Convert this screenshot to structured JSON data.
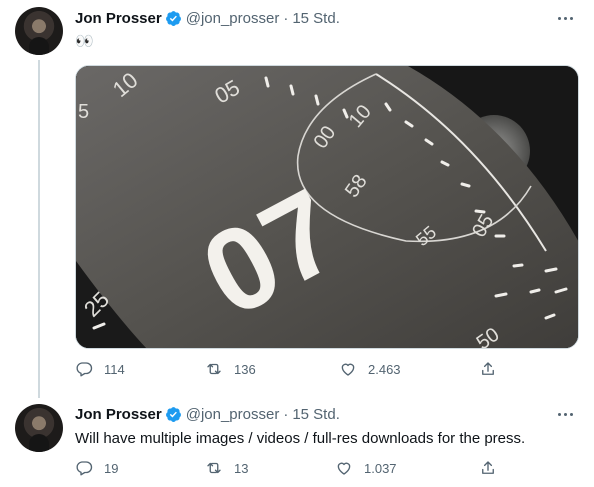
{
  "tweets": [
    {
      "author": "Jon Prosser",
      "handle": "@jon_prosser",
      "time": "15 Std.",
      "text": "👀",
      "media": {
        "numerals": {
          "large": "07",
          "upper_left": "10",
          "top": "05",
          "left_small": "25",
          "inner_top": "00",
          "inner_right": "10",
          "inner_mid": "58",
          "inner_lower": "55",
          "right": "05",
          "bottom_right": "50",
          "left_edge": "5"
        }
      },
      "stats": {
        "replies": "114",
        "retweets": "136",
        "likes": "2.463"
      }
    },
    {
      "author": "Jon Prosser",
      "handle": "@jon_prosser",
      "time": "15 Std.",
      "text": "Will have multiple images / videos / full-res downloads for the press.",
      "stats": {
        "replies": "19",
        "retweets": "13",
        "likes": "1.037"
      }
    }
  ],
  "colors": {
    "verified": "#1d9bf0",
    "secondary_text": "#536471",
    "thread_line": "#cfd9de"
  }
}
